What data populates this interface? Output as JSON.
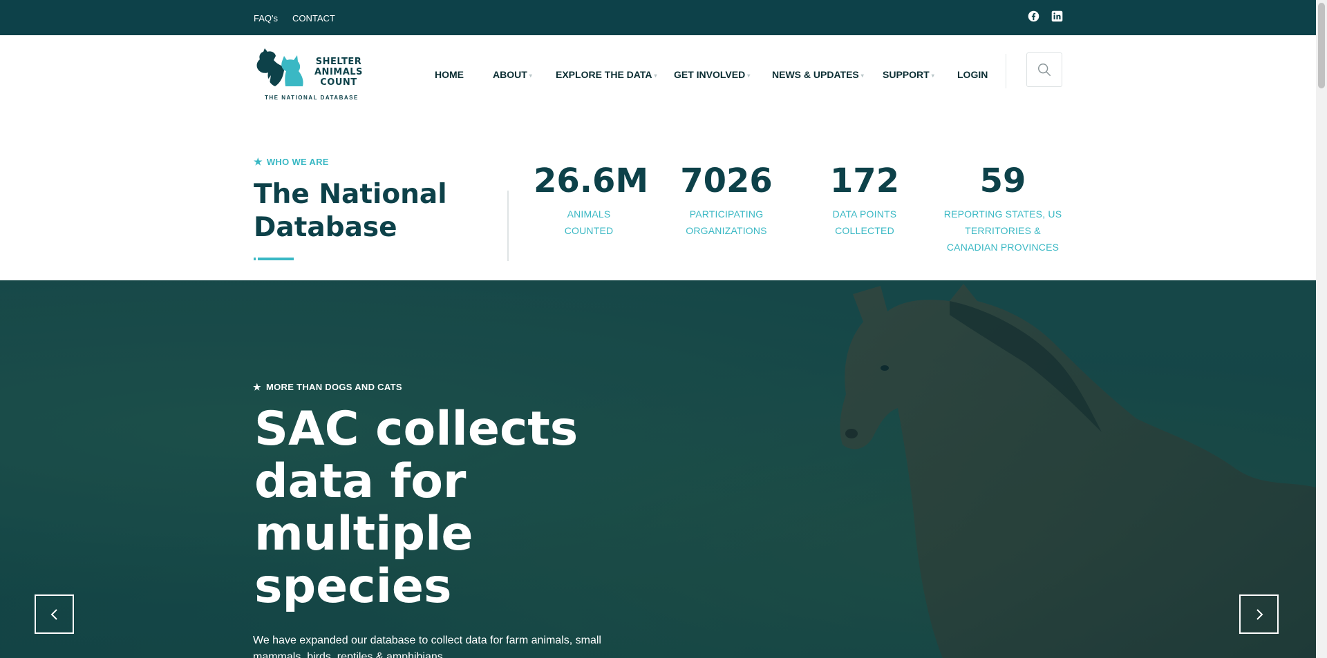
{
  "colors": {
    "dark": "#0d4149",
    "accent": "#3ab8c4",
    "white": "#ffffff"
  },
  "topbar": {
    "links": [
      "FAQ's",
      "CONTACT"
    ],
    "social_icons": [
      "facebook-icon",
      "linkedin-icon"
    ]
  },
  "header": {
    "logo": {
      "name_lines": [
        "SHELTER",
        "ANIMALS",
        "COUNT"
      ],
      "tagline": "THE NATIONAL DATABASE"
    },
    "nav": [
      {
        "label": "HOME",
        "dropdown": false
      },
      {
        "label": "ABOUT",
        "dropdown": true
      },
      {
        "label": "EXPLORE THE DATA",
        "dropdown": true
      },
      {
        "label": "GET INVOLVED",
        "dropdown": true
      },
      {
        "label": "NEWS & UPDATES",
        "dropdown": true
      },
      {
        "label": "SUPPORT",
        "dropdown": true
      },
      {
        "label": "LOGIN",
        "dropdown": false
      }
    ],
    "search_icon": "search-icon"
  },
  "stats_section": {
    "eyebrow": "WHO WE ARE",
    "title": "The National Database",
    "stats": [
      {
        "value": "26.6M",
        "label_lines": [
          "ANIMALS",
          "COUNTED"
        ]
      },
      {
        "value": "7026",
        "label_lines": [
          "PARTICIPATING",
          "ORGANIZATIONS"
        ]
      },
      {
        "value": "172",
        "label_lines": [
          "DATA POINTS",
          "COLLECTED"
        ]
      },
      {
        "value": "59",
        "label_lines": [
          "REPORTING STATES, US",
          "TERRITORIES &",
          "CANADIAN PROVINCES"
        ]
      }
    ]
  },
  "hero": {
    "eyebrow": "MORE THAN DOGS AND CATS",
    "title": "SAC collects data for multiple species",
    "description": "We have expanded our database to collect data for farm animals, small mammals, birds, reptiles & amphibians.",
    "prev_icon": "chevron-left-icon",
    "next_icon": "chevron-right-icon"
  }
}
